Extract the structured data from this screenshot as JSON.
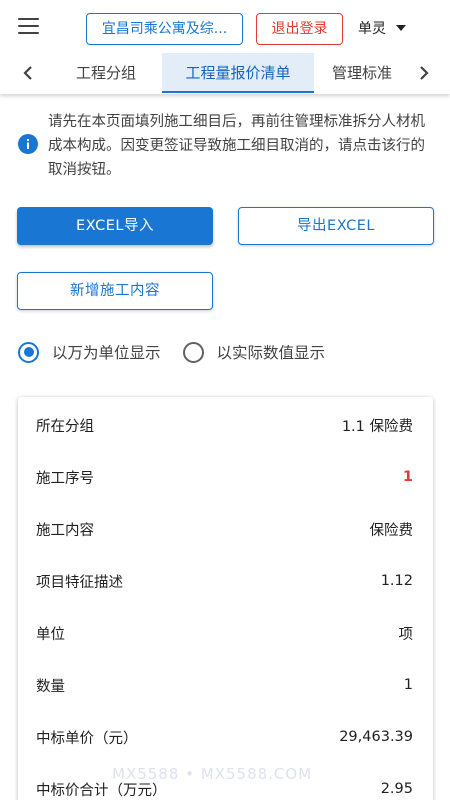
{
  "header": {
    "project_name": "宜昌司乘公寓及综...",
    "logout_label": "退出登录",
    "user_name": "单灵"
  },
  "tabs": [
    {
      "label": "工程分组",
      "active": false
    },
    {
      "label": "工程量报价清单",
      "active": true
    },
    {
      "label": "管理标准",
      "active": false
    }
  ],
  "notice": {
    "icon": "info-icon",
    "text": "请先在本页面填列施工细目后，再前往管理标准拆分人材机成本构成。因变更签证导致施工细目取消的，请点击该行的取消按钮。"
  },
  "actions": {
    "import_label": "EXCEL导入",
    "export_label": "导出EXCEL",
    "add_label": "新增施工内容"
  },
  "display_mode": {
    "options": [
      "以万为单位显示",
      "以实际数值显示"
    ],
    "selected": "以万为单位显示"
  },
  "detail_rows": [
    {
      "label": "所在分组",
      "value": "1.1 保险费"
    },
    {
      "label": "施工序号",
      "value": "1"
    },
    {
      "label": "施工内容",
      "value": "保险费"
    },
    {
      "label": "项目特征描述",
      "value": "1.12"
    },
    {
      "label": "单位",
      "value": "项"
    },
    {
      "label": "数量",
      "value": "1"
    },
    {
      "label": "中标单价（元）",
      "value": "29,463.39"
    },
    {
      "label": "中标价合计（万元）",
      "value": "2.95"
    }
  ],
  "watermark": "MX5588 • MX5588.COM",
  "colors": {
    "primary": "#1976d2",
    "danger": "#e53935",
    "active_tab_bg": "#e3edf8"
  }
}
